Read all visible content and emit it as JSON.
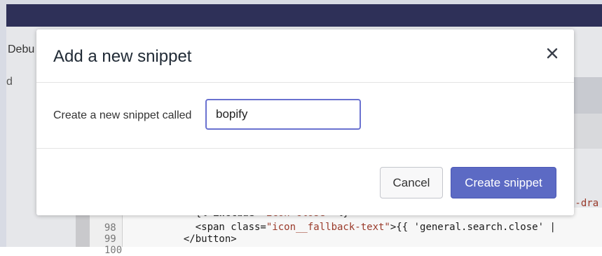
{
  "background": {
    "tab_label": "Debu",
    "left_text": "d",
    "code_side_text": "s-dra",
    "code_lines": [
      {
        "num": "98",
        "pre": "    {% ",
        "kw": "include",
        "str": " \"icon-close\"",
        "post": " %}"
      },
      {
        "num": "99",
        "pre": "    <span class=",
        "str": "\"icon__fallback-text\"",
        "post": ">{{ 'general.search.close' |"
      },
      {
        "num": "100",
        "pre": "  </button>",
        "str": "",
        "post": ""
      }
    ]
  },
  "modal": {
    "title": "Add a new snippet",
    "close_icon": "close-icon",
    "field_label": "Create a new snippet called",
    "input_value": "bopify",
    "cancel_label": "Cancel",
    "create_label": "Create snippet"
  },
  "colors": {
    "primary": "#5c6ac4",
    "input_focus": "#6a72d0",
    "topbar": "#2e3058"
  }
}
